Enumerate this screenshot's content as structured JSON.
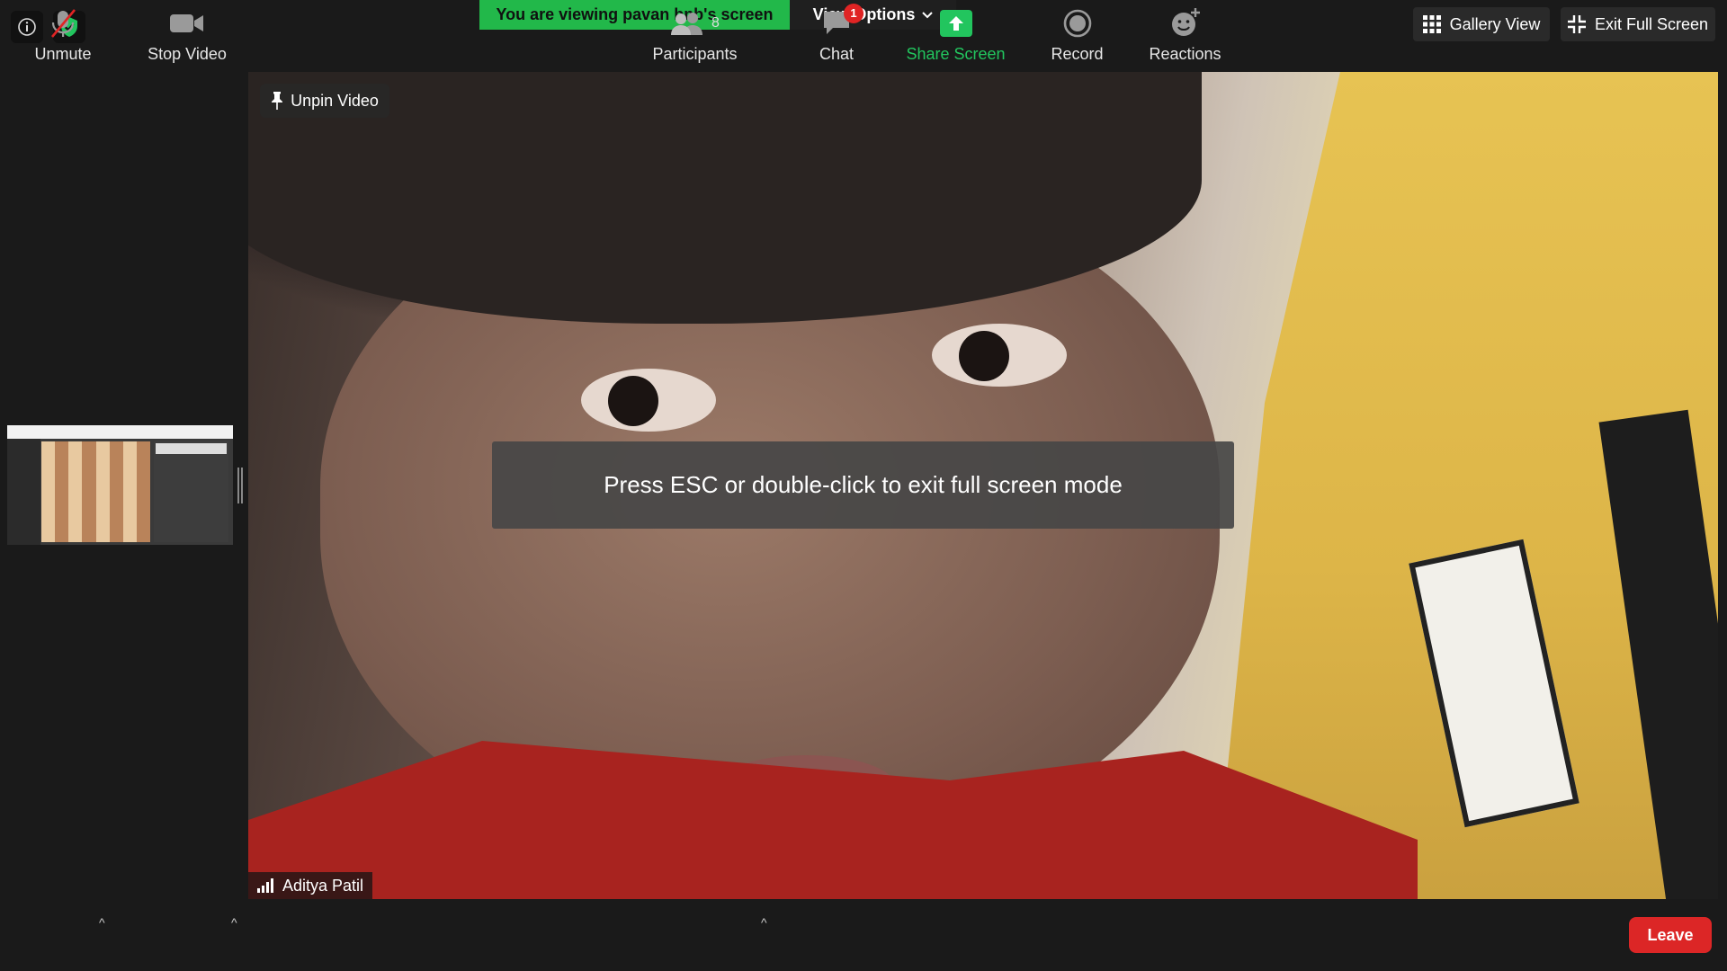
{
  "top_bar": {
    "viewing_banner": "You are viewing pavan bnb's screen",
    "view_options_label": "View Options",
    "gallery_view_label": "Gallery View",
    "exit_full_screen_label": "Exit Full Screen"
  },
  "video": {
    "unpin_label": "Unpin Video",
    "participant_name": "Aditya Patil",
    "fullscreen_hint": "Press ESC or double-click to exit full screen mode"
  },
  "toolbar": {
    "unmute_label": "Unmute",
    "stop_video_label": "Stop Video",
    "participants_label": "Participants",
    "participants_count": "8",
    "chat_label": "Chat",
    "chat_badge": "1",
    "share_screen_label": "Share Screen",
    "record_label": "Record",
    "reactions_label": "Reactions",
    "leave_label": "Leave"
  },
  "colors": {
    "share_green": "#22c55e",
    "banner_green": "#22b84a",
    "leave_red": "#dc2626"
  }
}
